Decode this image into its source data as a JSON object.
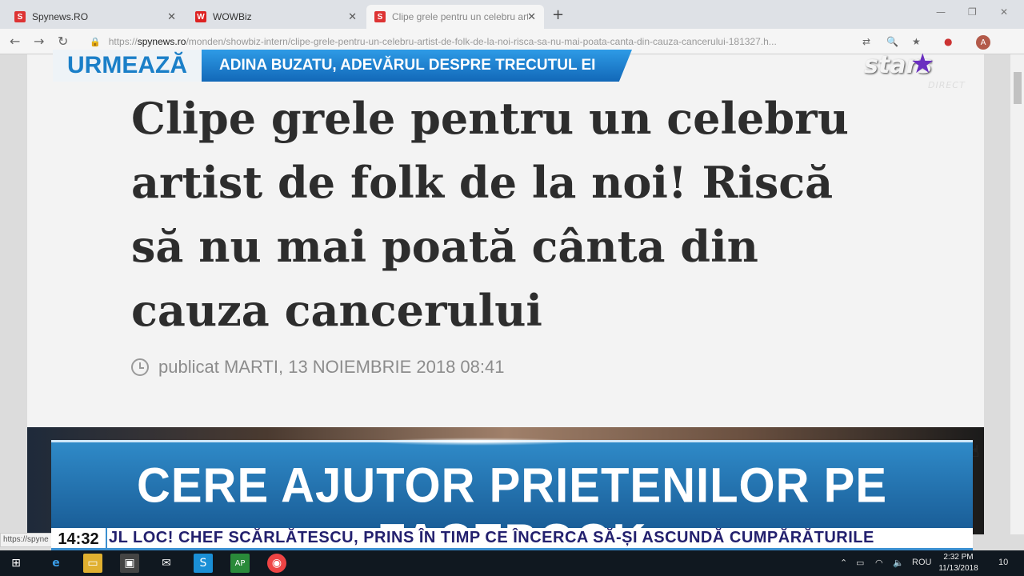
{
  "browser": {
    "tabs": [
      {
        "label": "Spynews.RO",
        "favicon": "S",
        "active": false
      },
      {
        "label": "WOWBiz",
        "favicon": "W",
        "active": false
      },
      {
        "label": "Clipe grele pentru un celebru art",
        "favicon": "S",
        "active": true
      }
    ],
    "url": {
      "scheme": "https://",
      "host": "spynews.ro",
      "path": "/monden/showbiz-intern/clipe-grele-pentru-un-celebru-artist-de-folk-de-la-noi-risca-sa-nu-mai-poata-canta-din-cauza-cancerului-181327.h..."
    },
    "avatar_initial": "A",
    "status_url": "https://spyne"
  },
  "article": {
    "title": "Clipe grele pentru un celebru artist de folk de la noi! Riscă să nu mai poată cânta din cauza cancerului",
    "published": "publicat MARTI, 13 NOIEMBRIE 2018 08:41"
  },
  "overlay": {
    "next_label": "URMEAZĂ",
    "next_title": "ADINA BUZATU, ADEVĂRUL DESPRE TRECUTUL EI",
    "logo_text": "stars",
    "logo_sub": "DIRECT",
    "headline": "CERE AJUTOR PRIETENILOR PE FACEBOOK",
    "ticker_time": "14:32",
    "ticker_text": "JL LOC! CHEF SCĂRLĂTESCU, PRINS ÎN TIMP CE ÎNCERCA SĂ-ȘI ASCUNDĂ CUMPĂRĂTURILE"
  },
  "taskbar": {
    "language": "ROU",
    "time": "2:32 PM",
    "date": "11/13/2018",
    "notification_count": "10"
  },
  "colors": {
    "overlay_blue": "#1a7fc8",
    "headline_bg": "#1a5e98",
    "ticker_text": "#23206e",
    "logo_star": "#6a2fc0"
  }
}
